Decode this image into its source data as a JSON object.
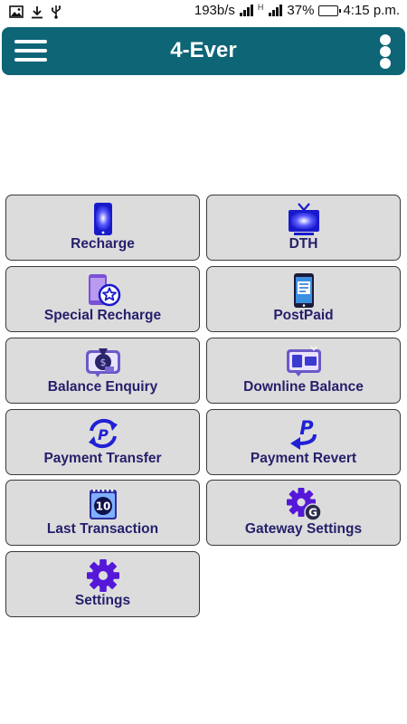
{
  "status_bar": {
    "icons": [
      "image-icon",
      "download-icon",
      "usb-icon"
    ],
    "speed": "193b/s",
    "network_label": "H",
    "battery": "37%",
    "battery_level": 0.37,
    "time": "4:15 p.m."
  },
  "app_bar": {
    "title": "4-Ever",
    "menu_icon": "hamburger-menu-icon",
    "more_icon": "more-vert-icon",
    "color": "#0d6576"
  },
  "colors": {
    "tile_bg": "#dcdcdc",
    "label": "#241f6b",
    "accent_blue": "#2323e0"
  },
  "tiles": [
    {
      "label": "Recharge",
      "icon": "mobile-phone-icon"
    },
    {
      "label": "DTH",
      "icon": "tv-icon"
    },
    {
      "label": "Special Recharge",
      "icon": "phone-star-icon"
    },
    {
      "label": "PostPaid",
      "icon": "phone-bill-icon"
    },
    {
      "label": "Balance Enquiry",
      "icon": "money-bag-icon"
    },
    {
      "label": "Downline Balance",
      "icon": "monitor-devices-icon"
    },
    {
      "label": "Payment Transfer",
      "icon": "paypal-transfer-icon"
    },
    {
      "label": "Payment Revert",
      "icon": "paypal-revert-icon"
    },
    {
      "label": "Last Transaction",
      "icon": "calendar-10-icon"
    },
    {
      "label": "Gateway Settings",
      "icon": "gear-g-icon"
    },
    {
      "label": "Settings",
      "icon": "gear-icon"
    }
  ]
}
